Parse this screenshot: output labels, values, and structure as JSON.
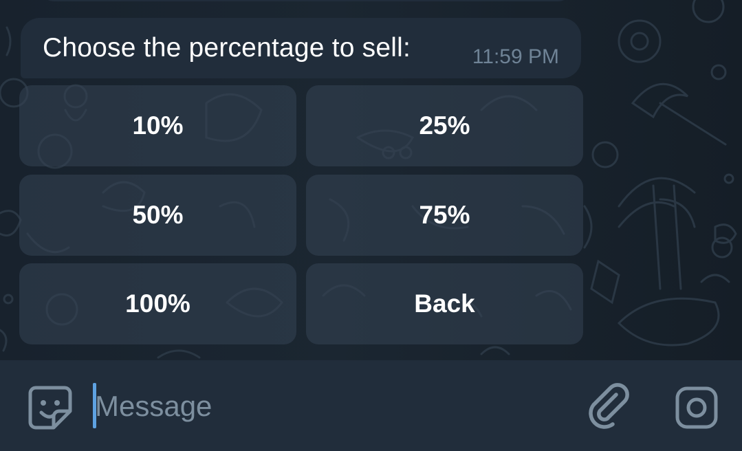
{
  "message": {
    "text": "Choose the percentage to sell:",
    "time": "11:59 PM"
  },
  "keyboard": {
    "buttons": [
      "10%",
      "25%",
      "50%",
      "75%",
      "100%",
      "Back"
    ]
  },
  "composer": {
    "placeholder": "Message",
    "value": ""
  },
  "icons": {
    "emoji": "sticker-emoji-icon",
    "attach": "paperclip-icon",
    "camera": "camera-icon"
  },
  "colors": {
    "chat_background": "#18222d",
    "bubble": "#212d3b",
    "keyboard_button": "#2c3846",
    "input_bar": "#212d3b",
    "caret": "#5ea2e2",
    "timestamp": "#6f8396",
    "icon": "#7d8f9f"
  }
}
